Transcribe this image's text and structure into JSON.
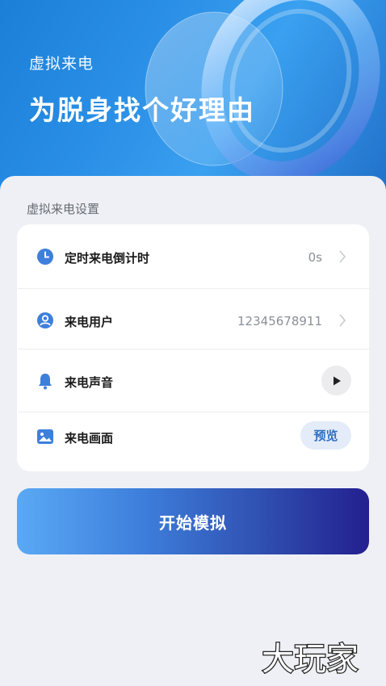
{
  "hero": {
    "subtitle": "虚拟来电",
    "title": "为脱身找个好理由"
  },
  "settings": {
    "section_label": "虚拟来电设置",
    "rows": [
      {
        "label": "定时来电倒计时",
        "value": "0s",
        "icon": "clock-icon"
      },
      {
        "label": "来电用户",
        "value": "12345678911",
        "icon": "user-icon"
      },
      {
        "label": "来电声音",
        "icon": "bell-icon"
      },
      {
        "label": "来电画面",
        "icon": "image-icon",
        "action": "预览"
      }
    ]
  },
  "start_button": {
    "label": "开始模拟"
  },
  "watermark": {
    "text": "大玩家"
  },
  "colors": {
    "accent_blue": "#3e7fdc",
    "hero_blue": "#2a8fe6",
    "button_gradient_end": "#231f8f",
    "preview_bg": "#e3ecf8"
  }
}
